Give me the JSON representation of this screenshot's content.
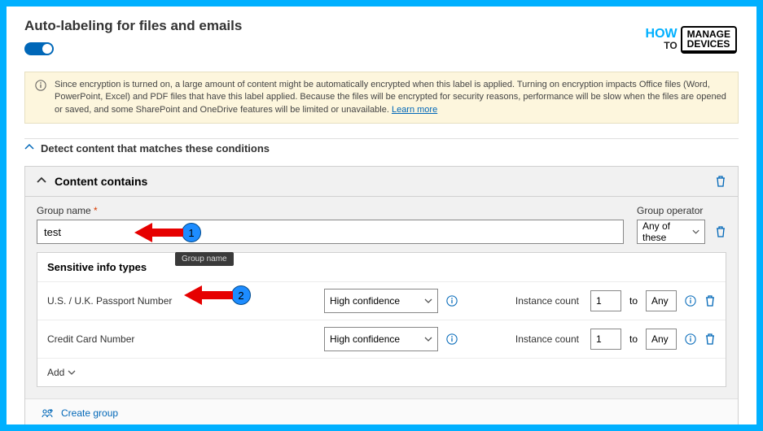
{
  "page": {
    "title": "Auto-labeling for files and emails",
    "toggle_on": true
  },
  "logo": {
    "how": "HOW",
    "to": "TO",
    "line1": "MANAGE",
    "line2": "DEVICES"
  },
  "banner": {
    "text": "Since encryption is turned on, a large amount of content might be automatically encrypted when this label is applied. Turning on encryption impacts Office files (Word, PowerPoint, Excel) and PDF files that have this label applied. Because the files will be encrypted for security reasons, performance will be slow when the files are opened or saved, and some SharePoint and OneDrive features will be limited or unavailable. ",
    "link": "Learn more"
  },
  "section": {
    "detect_header": "Detect content that matches these conditions",
    "content_contains": "Content contains"
  },
  "group": {
    "name_label": "Group name",
    "name_value": "test",
    "operator_label": "Group operator",
    "operator_value": "Any of these",
    "tooltip": "Group name"
  },
  "sensitive": {
    "header": "Sensitive info types",
    "rows": [
      {
        "name": "U.S. / U.K. Passport Number",
        "confidence": "High confidence",
        "instance_label": "Instance count",
        "from": "1",
        "to_label": "to",
        "to": "Any"
      },
      {
        "name": "Credit Card Number",
        "confidence": "High confidence",
        "instance_label": "Instance count",
        "from": "1",
        "to_label": "to",
        "to": "Any"
      }
    ],
    "add_label": "Add",
    "create_group": "Create group"
  },
  "annotations": {
    "marker1": "1",
    "marker2": "2"
  }
}
